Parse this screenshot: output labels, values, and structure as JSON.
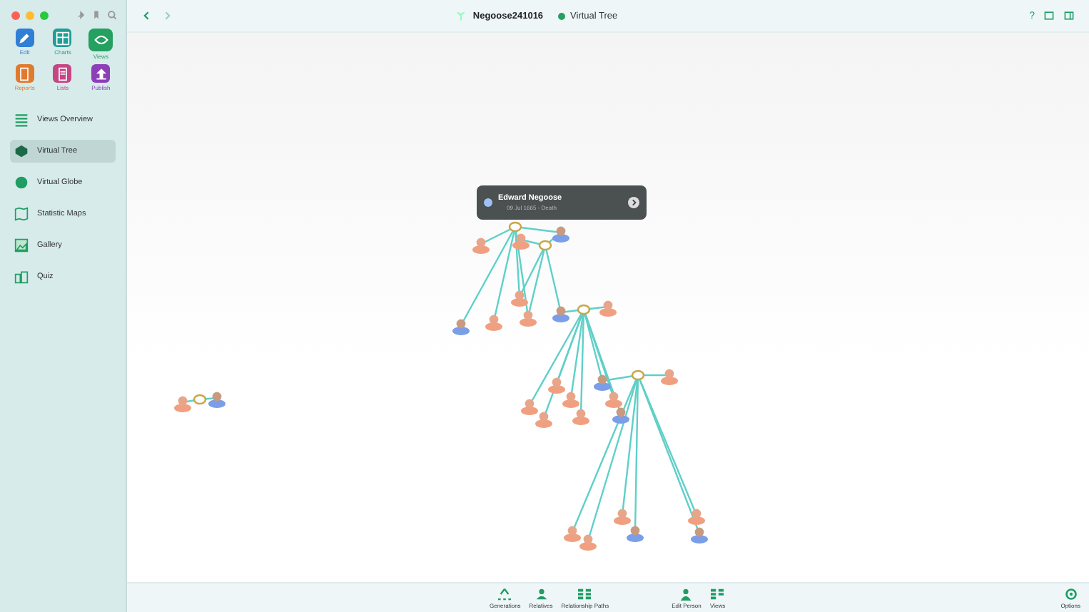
{
  "window": {
    "title": "Negoose241016",
    "view": "Virtual Tree",
    "help": "?"
  },
  "modules": [
    {
      "label": "Edit",
      "kind": "edit",
      "color": "#2f7fd6",
      "selected": false
    },
    {
      "label": "Charts",
      "kind": "charts",
      "color": "#1f9e96",
      "selected": false
    },
    {
      "label": "Views",
      "kind": "views",
      "color": "#24a061",
      "selected": true
    },
    {
      "label": "Reports",
      "kind": "reports",
      "color": "#e07a2e",
      "selected": false
    },
    {
      "label": "Lists",
      "kind": "lists",
      "color": "#c64585",
      "selected": false
    },
    {
      "label": "Publish",
      "kind": "publish",
      "color": "#8d3fb8",
      "selected": false
    }
  ],
  "sidebar": {
    "items": [
      {
        "label": "Views Overview",
        "kind": "overview",
        "selected": false
      },
      {
        "label": "Virtual Tree",
        "kind": "tree",
        "selected": true
      },
      {
        "label": "Virtual Globe",
        "kind": "globe",
        "selected": false
      },
      {
        "label": "Statistic Maps",
        "kind": "maps",
        "selected": false
      },
      {
        "label": "Gallery",
        "kind": "gallery",
        "selected": false
      },
      {
        "label": "Quiz",
        "kind": "quiz",
        "selected": false
      }
    ]
  },
  "popup": {
    "name": "Edward Negoose",
    "detail": "09 Jul 1665 - Death"
  },
  "toolbar": [
    {
      "label": "Generations",
      "kind": "generations"
    },
    {
      "label": "Relatives",
      "kind": "relatives"
    },
    {
      "label": "Relationship Paths",
      "kind": "paths"
    },
    {
      "label": "Edit Person",
      "kind": "person"
    },
    {
      "label": "Views",
      "kind": "views"
    }
  ],
  "options": {
    "label": "Options"
  }
}
